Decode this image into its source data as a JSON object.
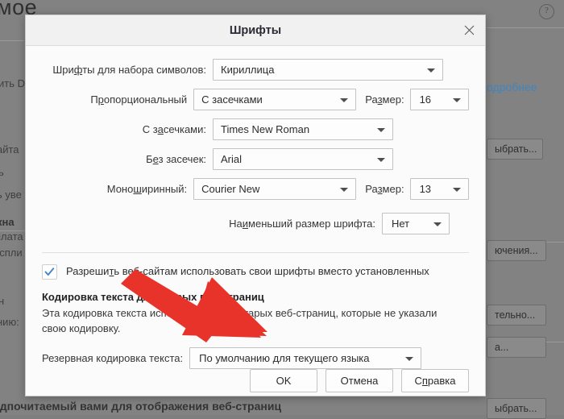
{
  "background": {
    "heading_fragment": "мое",
    "help_icon": "help-circle-icon",
    "text_fragments": [
      "ить D",
      "айта",
      "ь",
      "ь уве",
      "кна",
      "плата",
      "еспли",
      "н",
      "нию:",
      "едпочитаемый вами для отображения веб-страниц"
    ],
    "link_fragment": "одробнее",
    "buttons": [
      "ыбрать...",
      "ючения...",
      "тельно...",
      "а...",
      "ыбрать..."
    ]
  },
  "dialog": {
    "title": "Шрифты",
    "close_icon": "close-icon",
    "charset": {
      "label_pre": "Шри",
      "label_mnemonic": "ф",
      "label_post": "ты для набора символов:",
      "value": "Кириллица",
      "caret_icon": "chevron-down-icon"
    },
    "proportional": {
      "label_pre": "П",
      "label_mnemonic": "р",
      "label_post": "опорциональный",
      "value": "С засечками",
      "size_label_pre": "Ра",
      "size_label_mnemonic": "з",
      "size_label_post": "мер:",
      "size_value": "16"
    },
    "serif": {
      "label_pre": "С з",
      "label_mnemonic": "а",
      "label_post": "сечками:",
      "value": "Times New Roman"
    },
    "sans": {
      "label_pre": "Б",
      "label_mnemonic": "е",
      "label_post": "з засечек:",
      "value": "Arial"
    },
    "mono": {
      "label_pre": "Моно",
      "label_mnemonic": "ш",
      "label_post": "иринный:",
      "value": "Courier New",
      "size_label_pre": "Ра",
      "size_label_mnemonic": "з",
      "size_label_post": "мер:",
      "size_value": "13"
    },
    "minsize": {
      "label_pre": "На",
      "label_mnemonic": "и",
      "label_post": "меньший размер шрифта:",
      "value": "Нет"
    },
    "allow_web_fonts": {
      "checked": true,
      "check_icon": "checkmark-icon",
      "label_pre": "Разреши",
      "label_mnemonic": "т",
      "label_post": "ь веб-сайтам использовать свои шрифты вместо установленных"
    },
    "encoding_section": {
      "title": "Кодировка текста для старых веб-страниц",
      "description": "Эта кодировка текста используется для старых веб-страниц, которые не указали свою кодировку.",
      "fallback_label_pre": "Резервная ко",
      "fallback_label_mnemonic": "д",
      "fallback_label_post": "ировка текста:",
      "fallback_value": "По умолчанию для текущего языка"
    },
    "buttons": {
      "ok": "OK",
      "cancel": "Отмена",
      "help_pre": "С",
      "help_mnemonic": "п",
      "help_post": "равка"
    }
  },
  "annotation": {
    "arrow_color": "#e8332a",
    "arrow_name": "red-pointer-arrow",
    "points_to": "fallback-encoding-combo"
  },
  "colors": {
    "dialog_bg": "#fbfbfb",
    "titlebar_bg": "#f1f1f1",
    "backdrop": "#828282",
    "accent_check": "#3a86c8",
    "link": "#3a86c8"
  }
}
